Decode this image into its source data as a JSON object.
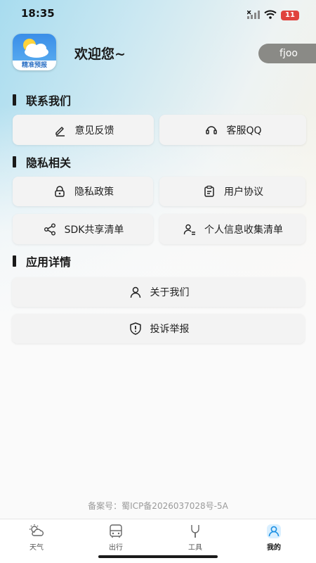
{
  "status_bar": {
    "time": "18:35",
    "battery": "11"
  },
  "header": {
    "app_badge": "精准预报",
    "welcome": "欢迎您~",
    "username": "fjoo"
  },
  "sections": {
    "contact": {
      "title": "联系我们",
      "feedback": "意见反馈",
      "qq": "客服QQ"
    },
    "privacy": {
      "title": "隐私相关",
      "policy": "隐私政策",
      "agreement": "用户协议",
      "sdk": "SDK共享清单",
      "personal_info": "个人信息收集清单"
    },
    "app": {
      "title": "应用详情",
      "about": "关于我们",
      "report": "投诉举报"
    }
  },
  "footer": {
    "icp": "备案号：蜀ICP备2026037028号-5A"
  },
  "bottom_nav": [
    {
      "label": "天气",
      "icon": "weather-icon"
    },
    {
      "label": "出行",
      "icon": "bus-icon"
    },
    {
      "label": "工具",
      "icon": "tools-icon"
    },
    {
      "label": "我的",
      "icon": "profile-icon",
      "active": true
    }
  ],
  "colors": {
    "accent": "#1a8fe3",
    "card_bg": "#f3f3f3"
  }
}
